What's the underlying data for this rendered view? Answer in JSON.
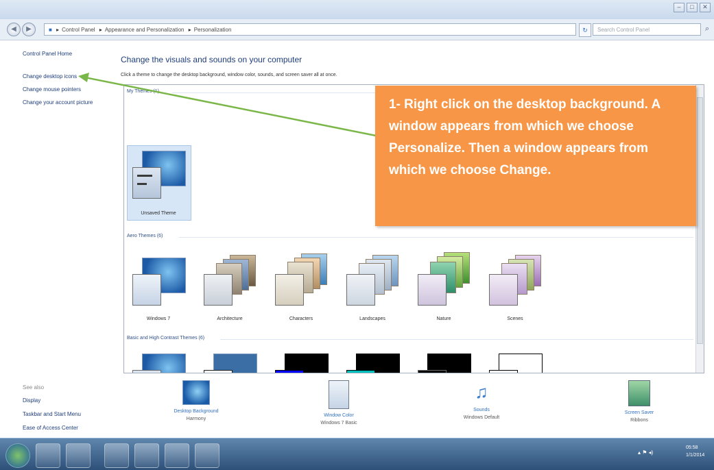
{
  "breadcrumb": [
    "Control Panel",
    "Appearance and Personalization",
    "Personalization"
  ],
  "search_placeholder": "Search Control Panel",
  "sidebar": {
    "links": [
      "Control Panel Home",
      "Change desktop icons",
      "Change mouse pointers",
      "Change your account picture"
    ],
    "see_also": "See also",
    "see_also_links": [
      "Display",
      "Taskbar and Start Menu",
      "Ease of Access Center"
    ]
  },
  "main": {
    "title": "Change the visuals and sounds on your computer",
    "subtitle": "Click a theme to change the desktop background, window color, sounds, and screen saver all at once.",
    "sections": {
      "my_themes": "My Themes (1)",
      "aero_themes": "Aero Themes (6)",
      "basic_themes": "Basic and High Contrast Themes (6)"
    },
    "my_themes": [
      "Unsaved Theme"
    ],
    "aero_themes": [
      "Windows 7",
      "Architecture",
      "Characters",
      "Landscapes",
      "Nature",
      "Scenes"
    ]
  },
  "bottom": [
    {
      "label": "Desktop Background",
      "value": "Harmony",
      "icon": "desktop-background-icon"
    },
    {
      "label": "Window Color",
      "value": "Windows 7 Basic",
      "icon": "window-color-icon"
    },
    {
      "label": "Sounds",
      "value": "Windows Default",
      "icon": "sounds-icon"
    },
    {
      "label": "Screen Saver",
      "value": "Ribbons",
      "icon": "screen-saver-icon"
    }
  ],
  "callout": "1- Right click on the desktop background. A window appears from which we choose Personalize. Then a window appears from which we choose Change.",
  "colors": {
    "callout": "#f79646",
    "arrow": "#7ab648",
    "link": "#1e3d7c"
  },
  "clock": {
    "time": "05:58",
    "date": "1/1/2014"
  }
}
